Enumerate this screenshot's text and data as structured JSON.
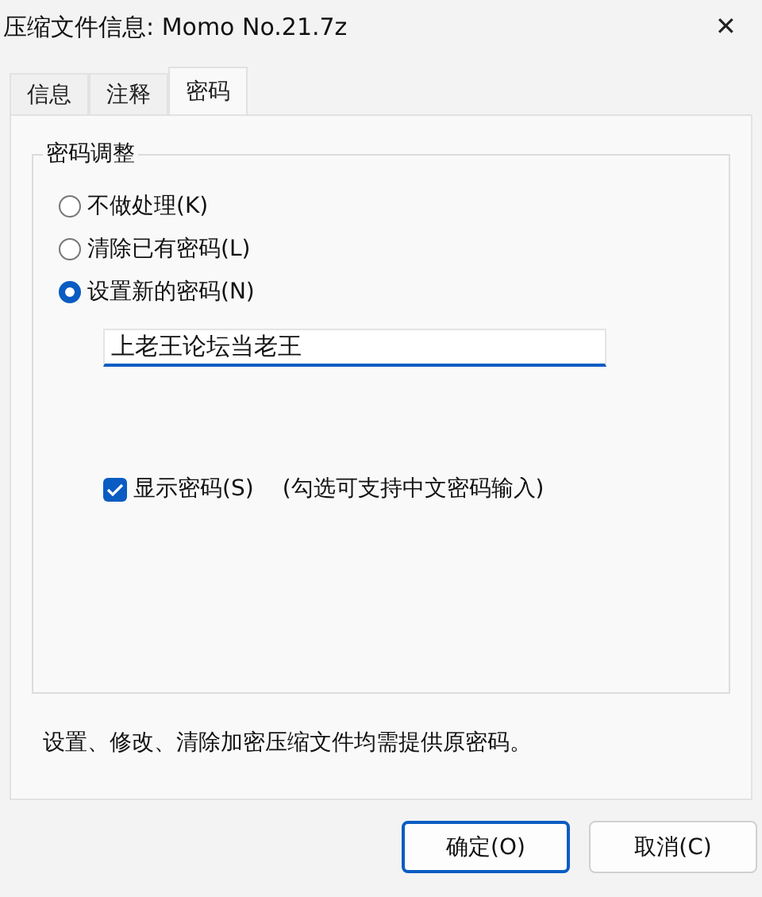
{
  "window": {
    "title": "压缩文件信息: Momo No.21.7z",
    "close": "✕"
  },
  "tabs": [
    {
      "label": "信息",
      "selected": false
    },
    {
      "label": "注释",
      "selected": false
    },
    {
      "label": "密码",
      "selected": true
    }
  ],
  "group": {
    "title": "密码调整",
    "options": [
      {
        "label": "不做处理(K)",
        "selected": false
      },
      {
        "label": "清除已有密码(L)",
        "selected": false
      },
      {
        "label": "设置新的密码(N)",
        "selected": true
      }
    ],
    "password": {
      "value": "上老王论坛当老王"
    },
    "show_password": {
      "label": "显示密码(S)",
      "checked": true,
      "hint": "(勾选可支持中文密码输入)"
    }
  },
  "note": "设置、修改、清除加密压缩文件均需提供原密码。",
  "buttons": [
    {
      "label": "确定(O)",
      "default": true
    },
    {
      "label": "取消(C)",
      "default": false
    }
  ]
}
